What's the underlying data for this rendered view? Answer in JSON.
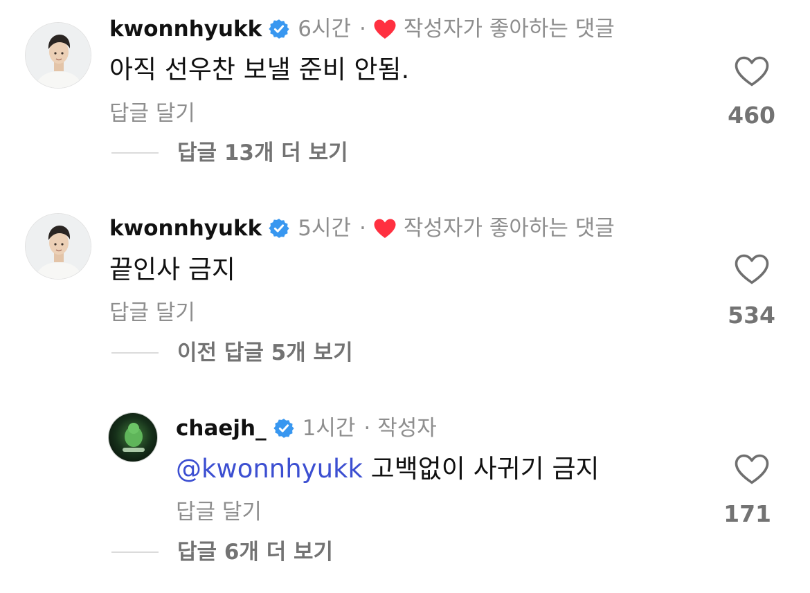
{
  "comments": [
    {
      "username": "kwonnhyukk",
      "time": "6시간",
      "dot": "·",
      "liked_by_author": "작성자가 좋아하는 댓글",
      "text": "아직 선우찬 보낼 준비 안됨.",
      "reply_label": "답글 달기",
      "like_count": "460",
      "more_replies": "답글 13개 더 보기"
    },
    {
      "username": "kwonnhyukk",
      "time": "5시간",
      "dot": "·",
      "liked_by_author": "작성자가 좋아하는 댓글",
      "text": "끝인사 금지",
      "reply_label": "답글 달기",
      "like_count": "534",
      "more_replies": "이전 답글 5개 보기"
    }
  ],
  "reply": {
    "username": "chaejh_",
    "time": "1시간",
    "dot": "·",
    "author_tag": "작성자",
    "mention": "@kwonnhyukk",
    "text": "고백없이 사귀기 금지",
    "reply_label": "답글 달기",
    "like_count": "171",
    "more_replies": "답글 6개 더 보기"
  },
  "icons": {
    "verified": "verified-badge-icon",
    "liked_heart": "red-heart-icon",
    "like": "heart-outline-icon"
  },
  "colors": {
    "verified_blue": "#3897f0",
    "heart_red": "#ff3040",
    "mention_blue": "#3c4fd1",
    "muted_gray": "#8e8e8e"
  }
}
